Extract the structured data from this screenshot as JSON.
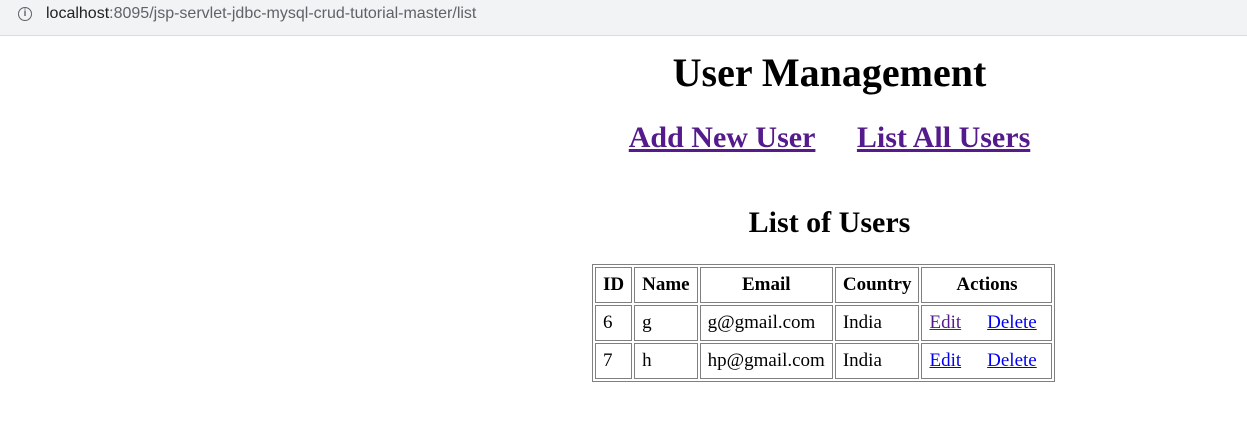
{
  "browser": {
    "url_host": "localhost",
    "url_path": ":8095/jsp-servlet-jdbc-mysql-crud-tutorial-master/list",
    "info_icon": "i"
  },
  "header": {
    "title": "User Management"
  },
  "nav": {
    "add_user": "Add New User",
    "list_users": "List All Users"
  },
  "list": {
    "title": "List of Users",
    "columns": [
      "ID",
      "Name",
      "Email",
      "Country",
      "Actions"
    ],
    "rows": [
      {
        "id": "6",
        "name": "g",
        "email": "g@gmail.com",
        "country": "India",
        "edit": "Edit",
        "delete": "Delete"
      },
      {
        "id": "7",
        "name": "h",
        "email": "hp@gmail.com",
        "country": "India",
        "edit": "Edit",
        "delete": "Delete"
      }
    ]
  },
  "colors": {
    "visited_link": "#551a8b",
    "link": "#0000ee"
  }
}
